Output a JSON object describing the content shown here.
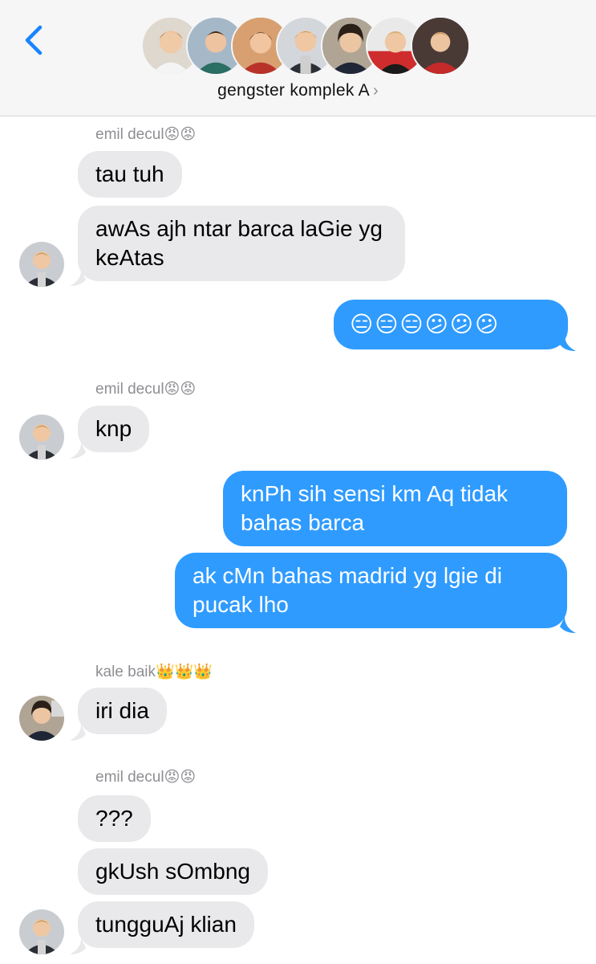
{
  "header": {
    "group_name": "gengster komplek A",
    "chevron": "›",
    "avatar_count": 7,
    "back_icon": "chevron-left-icon"
  },
  "colors": {
    "incoming_bubble": "#e9e9eb",
    "outgoing_bubble": "#2f9bff",
    "accent": "#1a84ff",
    "sender_label": "#8e8e93"
  },
  "messages": {
    "m1_sender": "emil decul😡😡",
    "m1_text": "tau tuh",
    "m2_text": "awAs ajh ntar barca laGie yg keAtas",
    "m3_text": "😑😑😑😕😕😕",
    "m4_sender": "emil decul😡😡",
    "m4_text": "knp",
    "m5_text": "knPh sih sensi km Aq tidak bahas barca",
    "m6_text": "ak cMn bahas madrid yg lgie di pucak lho",
    "m7_sender": "kale baik👑👑👑",
    "m7_text": "iri dia",
    "m8_sender": "emil decul😡😡",
    "m8_text": "???",
    "m9_text": "gkUsh sOmbng",
    "m10_text": "tungguAj klian"
  }
}
